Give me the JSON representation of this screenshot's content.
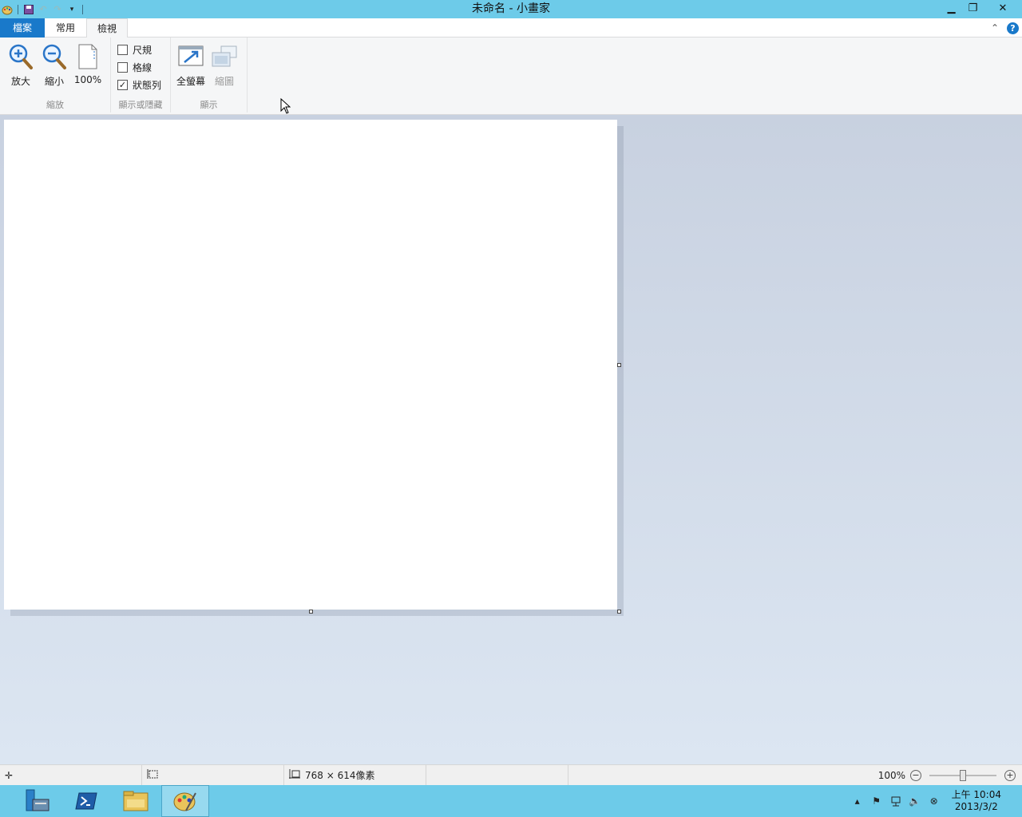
{
  "window": {
    "title": "未命名 - 小畫家",
    "minimize": "▁",
    "restore": "❐",
    "close": "✕"
  },
  "tabs": [
    {
      "label": "檔案"
    },
    {
      "label": "常用"
    },
    {
      "label": "檢視"
    }
  ],
  "ribbon": {
    "zoom_group": {
      "label": "縮放",
      "zoom_in": "放大",
      "zoom_out": "縮小",
      "actual": "100%"
    },
    "show_group": {
      "label": "顯示或隱藏",
      "ruler": "尺規",
      "ruler_checked": false,
      "gridlines": "格線",
      "gridlines_checked": false,
      "statusbar": "狀態列",
      "statusbar_checked": true,
      "check_mark": "✓"
    },
    "display_group": {
      "label": "顯示",
      "fullscreen": "全螢幕",
      "thumbnail": "縮圖"
    }
  },
  "statusbar": {
    "image_size": "768 × 614像素",
    "zoom": "100%",
    "zoom_value_pct": 100,
    "zoom_minus": "−",
    "zoom_plus": "+"
  },
  "taskbar": {
    "clock_time": "上午 10:04",
    "clock_date": "2013/3/2"
  },
  "colors": {
    "accent": "#6dcbe9",
    "file_tab": "#1979ca"
  }
}
